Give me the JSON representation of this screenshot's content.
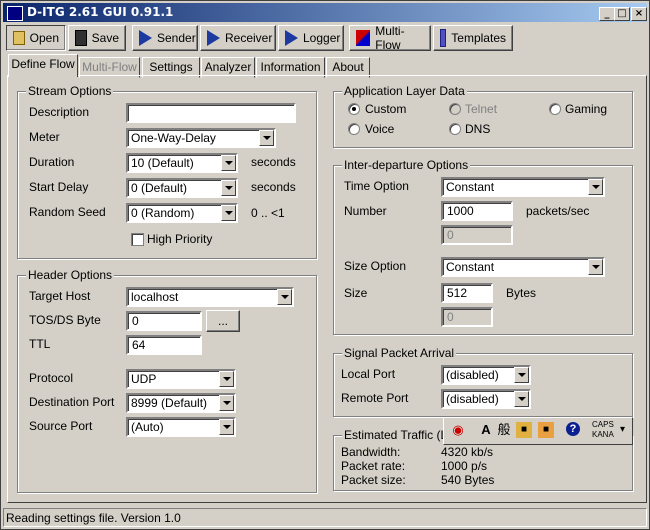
{
  "window": {
    "title": "D-ITG 2.61 GUI 0.91.1",
    "minimize": "_",
    "maximize": "□",
    "close": "×"
  },
  "toolbar": {
    "open": "Open",
    "save": "Save",
    "sender": "Sender",
    "receiver": "Receiver",
    "logger": "Logger",
    "multiflow": "Multi-Flow",
    "templates": "Templates"
  },
  "tabs": [
    "Define Flow",
    "Multi-Flow",
    "Settings",
    "Analyzer",
    "Information",
    "About"
  ],
  "stream": {
    "title": "Stream Options",
    "description_label": "Description",
    "description_value": "",
    "meter_label": "Meter",
    "meter_value": "One-Way-Delay",
    "duration_label": "Duration",
    "duration_value": "10 (Default)",
    "duration_unit": "seconds",
    "startdelay_label": "Start Delay",
    "startdelay_value": "0 (Default)",
    "startdelay_unit": "seconds",
    "seed_label": "Random Seed",
    "seed_value": "0 (Random)",
    "seed_hint": "0 .. <1",
    "priority_label": "High Priority",
    "priority_checked": false
  },
  "header": {
    "title": "Header Options",
    "host_label": "Target Host",
    "host_value": "localhost",
    "tos_label": "TOS/DS Byte",
    "tos_value": "0",
    "tos_button": "...",
    "ttl_label": "TTL",
    "ttl_value": "64",
    "protocol_label": "Protocol",
    "protocol_value": "UDP",
    "dport_label": "Destination Port",
    "dport_value": "8999 (Default)",
    "sport_label": "Source Port",
    "sport_value": "(Auto)"
  },
  "app": {
    "title": "Application Layer Data",
    "custom": "Custom",
    "telnet": "Telnet",
    "gaming": "Gaming",
    "voice": "Voice",
    "dns": "DNS",
    "selected": "Custom"
  },
  "idt": {
    "title": "Inter-departure Options",
    "time_label": "Time Option",
    "time_value": "Constant",
    "number_label": "Number",
    "number_value": "1000",
    "number_unit": "packets/sec",
    "number_extra": "0",
    "size_label": "Size Option",
    "size_value": "Constant",
    "sz_label": "Size",
    "sz_value": "512",
    "sz_unit": "Bytes",
    "sz_extra": "0"
  },
  "signal": {
    "title": "Signal Packet Arrival",
    "local_label": "Local Port",
    "local_value": "(disabled)",
    "remote_label": "Remote Port",
    "remote_value": "(disabled)"
  },
  "traffic": {
    "title": "Estimated Traffic (Lay",
    "bw_label": "Bandwidth:",
    "bw_value": "4320 kb/s",
    "rate_label": "Packet rate:",
    "rate_value": "1000 p/s",
    "size_label": "Packet size:",
    "size_value": "540 Bytes"
  },
  "ime": {
    "a": "A",
    "han": "般",
    "caps": "CAPS",
    "kana": "KANA",
    "help": "?"
  },
  "statusbar": "Reading settings file. Version 1.0"
}
